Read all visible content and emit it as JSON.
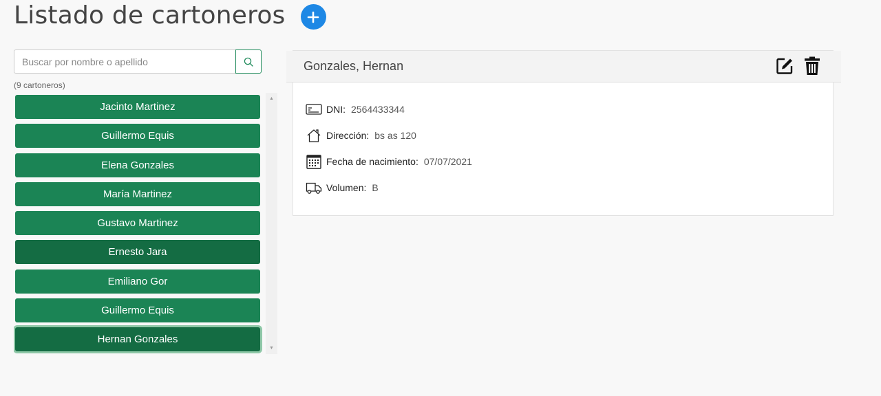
{
  "header": {
    "title": "Listado de cartoneros",
    "add_icon": "plus-circle-icon",
    "accent_color": "#1e88e5"
  },
  "search": {
    "placeholder": "Buscar por nombre o apellido",
    "value": "",
    "button_icon": "search-icon"
  },
  "list": {
    "count_label": "(9 cartoneros)",
    "item_color": "#1b8455",
    "items": [
      {
        "label": "Jacinto Martinez"
      },
      {
        "label": "Guillermo Equis"
      },
      {
        "label": "Elena Gonzales"
      },
      {
        "label": "María Martinez"
      },
      {
        "label": "Gustavo Martinez"
      },
      {
        "label": "Ernesto Jara"
      },
      {
        "label": "Emiliano Gor"
      },
      {
        "label": "Guillermo Equis"
      },
      {
        "label": "Hernan Gonzales"
      }
    ]
  },
  "detail": {
    "name": "Gonzales, Hernan",
    "edit_icon": "edit-icon",
    "delete_icon": "trash-icon",
    "fields": [
      {
        "icon": "id-card-icon",
        "label": "DNI:",
        "value": "2564433344"
      },
      {
        "icon": "home-icon",
        "label": "Dirección:",
        "value": "bs as 120"
      },
      {
        "icon": "calendar-icon",
        "label": "Fecha de nacimiento:",
        "value": "07/07/2021"
      },
      {
        "icon": "truck-icon",
        "label": "Volumen:",
        "value": "B"
      }
    ]
  }
}
